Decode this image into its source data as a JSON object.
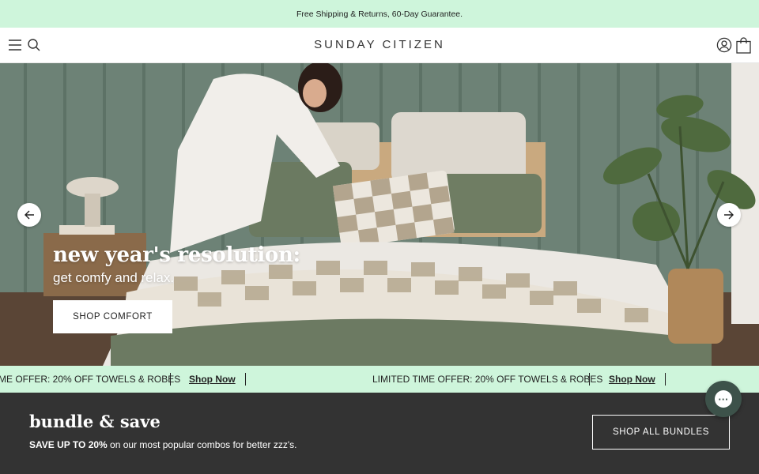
{
  "announcement": {
    "text": "Free Shipping & Returns, 60-Day Guarantee."
  },
  "header": {
    "logo": "SUNDAY CITIZEN",
    "icons": {
      "menu": "hamburger-icon",
      "search": "search-icon",
      "account": "user-icon",
      "cart": "shopping-bag-icon"
    }
  },
  "hero": {
    "title": "new year's resolution:",
    "subtitle": "get comfy and relax.",
    "cta_label": "SHOP COMFORT",
    "prev_icon": "arrow-left-icon",
    "next_icon": "arrow-right-icon"
  },
  "marquee": {
    "items": [
      {
        "text": "ME OFFER: 20% OFF TOWELS & ROBES",
        "link": "Shop Now"
      },
      {
        "text": "LIMITED TIME OFFER: 20% OFF TOWELS & ROBES",
        "link": "Shop Now"
      }
    ]
  },
  "bundle": {
    "title": "bundle & save",
    "desc_bold": "SAVE UP TO 20%",
    "desc_rest": " on our most popular combos for better zzz's.",
    "cta_label": "SHOP ALL BUNDLES"
  },
  "chat": {
    "icon": "chat-bubble-icon",
    "glyph": "···"
  },
  "colors": {
    "mint": "#cef5db",
    "dark": "#333333",
    "sage": "#6e8275",
    "chat": "#3d524a"
  }
}
